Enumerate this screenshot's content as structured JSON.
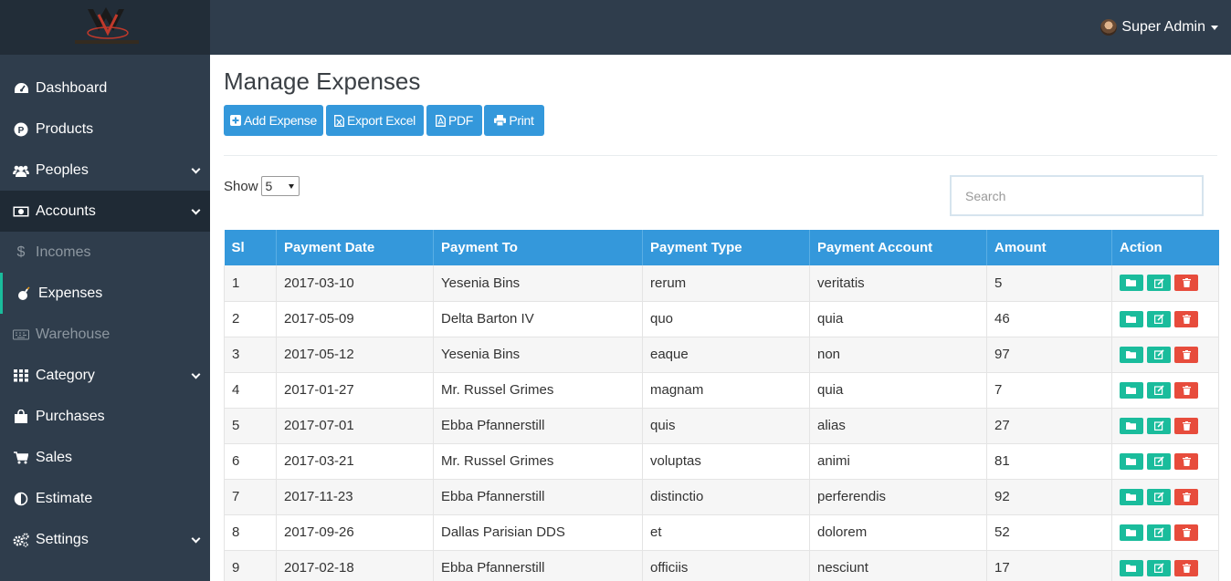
{
  "header": {
    "user_name": "Super Admin"
  },
  "sidebar": {
    "items": [
      {
        "label": "Dashboard",
        "icon": "dashboard-icon"
      },
      {
        "label": "Products",
        "icon": "product-icon"
      },
      {
        "label": "Peoples",
        "icon": "users-icon",
        "has_submenu": true
      },
      {
        "label": "Accounts",
        "icon": "money-icon",
        "has_submenu": true,
        "expanded": true
      },
      {
        "label": "Incomes",
        "icon": "dollar-icon",
        "submenu": true
      },
      {
        "label": "Expenses",
        "icon": "bomb-icon",
        "submenu": true,
        "selected": true
      },
      {
        "label": "Warehouse",
        "icon": "keyboard-icon",
        "submenu": true
      },
      {
        "label": "Category",
        "icon": "grid-icon",
        "has_submenu": true
      },
      {
        "label": "Purchases",
        "icon": "shopping-bag-icon"
      },
      {
        "label": "Sales",
        "icon": "cart-icon"
      },
      {
        "label": "Estimate",
        "icon": "half-circle-icon"
      },
      {
        "label": "Settings",
        "icon": "cogs-icon",
        "has_submenu": true
      }
    ]
  },
  "main": {
    "title": "Manage Expenses",
    "buttons": {
      "add": "Add Expense",
      "excel": "Export Excel",
      "pdf": "PDF",
      "print": "Print"
    },
    "show_label": "Show",
    "page_size": "5",
    "search_placeholder": "Search"
  },
  "table": {
    "headers": {
      "sl": "Sl",
      "date": "Payment Date",
      "to": "Payment To",
      "type": "Payment Type",
      "account": "Payment Account",
      "amount": "Amount",
      "action": "Action"
    },
    "rows": [
      {
        "sl": "1",
        "date": "2017-03-10",
        "to": "Yesenia Bins",
        "type": "rerum",
        "account": "veritatis",
        "amount": "5"
      },
      {
        "sl": "2",
        "date": "2017-05-09",
        "to": "Delta Barton IV",
        "type": "quo",
        "account": "quia",
        "amount": "46"
      },
      {
        "sl": "3",
        "date": "2017-05-12",
        "to": "Yesenia Bins",
        "type": "eaque",
        "account": "non",
        "amount": "97"
      },
      {
        "sl": "4",
        "date": "2017-01-27",
        "to": "Mr. Russel Grimes",
        "type": "magnam",
        "account": "quia",
        "amount": "7"
      },
      {
        "sl": "5",
        "date": "2017-07-01",
        "to": "Ebba Pfannerstill",
        "type": "quis",
        "account": "alias",
        "amount": "27"
      },
      {
        "sl": "6",
        "date": "2017-03-21",
        "to": "Mr. Russel Grimes",
        "type": "voluptas",
        "account": "animi",
        "amount": "81"
      },
      {
        "sl": "7",
        "date": "2017-11-23",
        "to": "Ebba Pfannerstill",
        "type": "distinctio",
        "account": "perferendis",
        "amount": "92"
      },
      {
        "sl": "8",
        "date": "2017-09-26",
        "to": "Dallas Parisian DDS",
        "type": "et",
        "account": "dolorem",
        "amount": "52"
      },
      {
        "sl": "9",
        "date": "2017-02-18",
        "to": "Ebba Pfannerstill",
        "type": "officiis",
        "account": "nesciunt",
        "amount": "17"
      }
    ]
  },
  "colors": {
    "primary": "#3498db",
    "sidebar": "#2f3d4c",
    "success": "#1abc9c",
    "danger": "#e74c3c"
  }
}
